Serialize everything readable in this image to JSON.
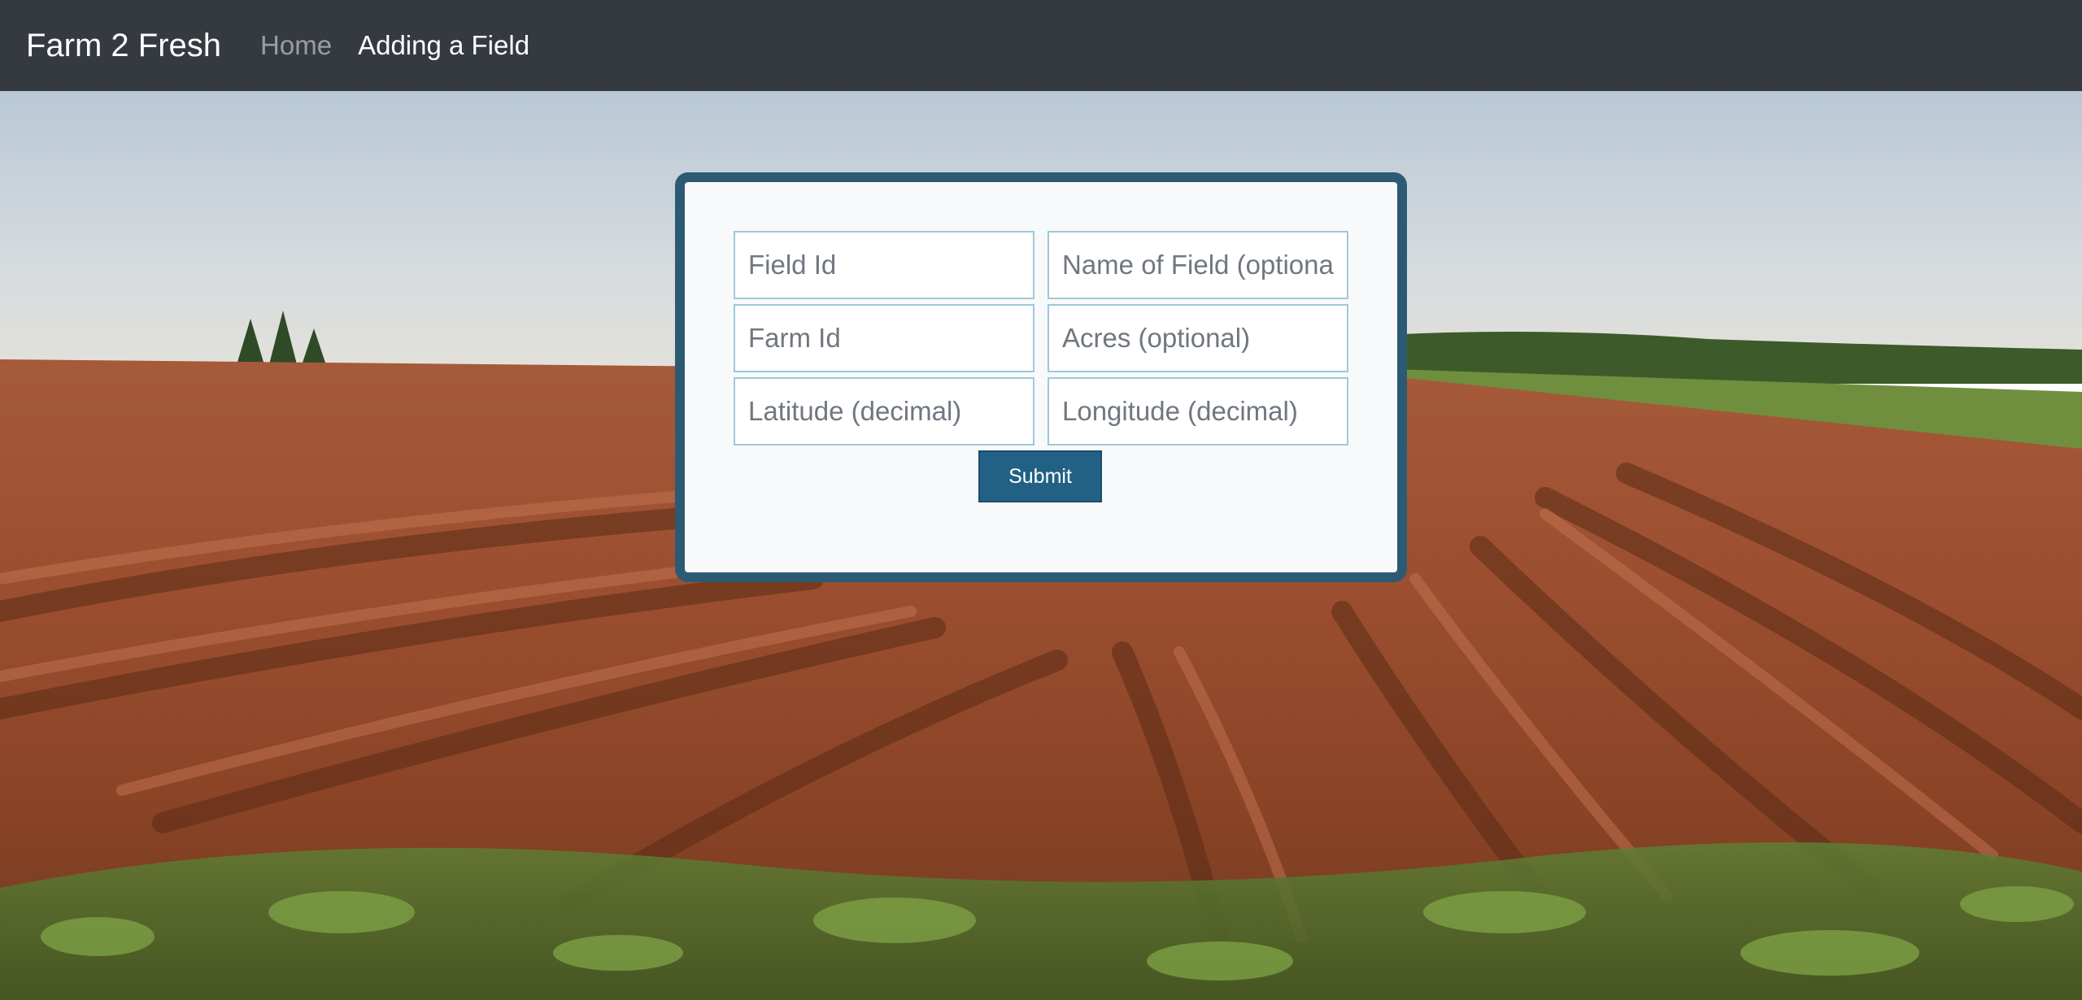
{
  "navbar": {
    "brand": "Farm 2 Fresh",
    "links": [
      {
        "label": "Home",
        "active": false
      },
      {
        "label": "Adding a Field",
        "active": true
      }
    ]
  },
  "form": {
    "field_id": {
      "placeholder": "Field Id",
      "value": ""
    },
    "field_name": {
      "placeholder": "Name of Field (optional)",
      "value": ""
    },
    "farm_id": {
      "placeholder": "Farm Id",
      "value": ""
    },
    "acres": {
      "placeholder": "Acres (optional)",
      "value": ""
    },
    "latitude": {
      "placeholder": "Latitude (decimal)",
      "value": ""
    },
    "longitude": {
      "placeholder": "Longitude (decimal)",
      "value": ""
    },
    "submit_label": "Submit"
  },
  "colors": {
    "navbar_bg": "#343a40",
    "card_border": "#2d5a73",
    "submit_bg": "#226185",
    "input_border": "#9fc8dc"
  },
  "background_image": "farm field with plowed red soil rows under a pale sky"
}
